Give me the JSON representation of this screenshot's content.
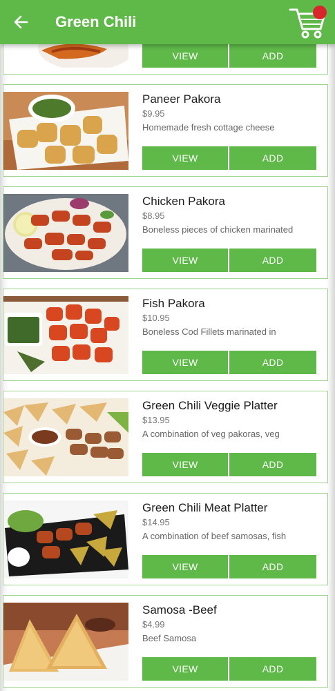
{
  "header": {
    "title": "Green Chili",
    "back_icon": "arrow-left-icon",
    "cart_icon": "shopping-cart-icon",
    "badge_color": "#d9262c",
    "accent": "#5fb948"
  },
  "buttons": {
    "view": "VIEW",
    "add": "ADD"
  },
  "items": [
    {
      "name": "",
      "price": "",
      "desc": ""
    },
    {
      "name": "Paneer Pakora",
      "price": "$9.95",
      "desc": "Homemade fresh cottage cheese"
    },
    {
      "name": "Chicken Pakora",
      "price": "$8.95",
      "desc": "Boneless pieces of chicken marinated"
    },
    {
      "name": "Fish Pakora",
      "price": "$10.95",
      "desc": "Boneless Cod Fillets marinated in"
    },
    {
      "name": "Green Chili Veggie Platter",
      "price": "$13.95",
      "desc": "A combination of veg pakoras, veg"
    },
    {
      "name": "Green Chili Meat Platter",
      "price": "$14.95",
      "desc": "A combination of beef samosas, fish"
    },
    {
      "name": "Samosa -Beef",
      "price": "$4.99",
      "desc": "Beef Samosa"
    }
  ]
}
